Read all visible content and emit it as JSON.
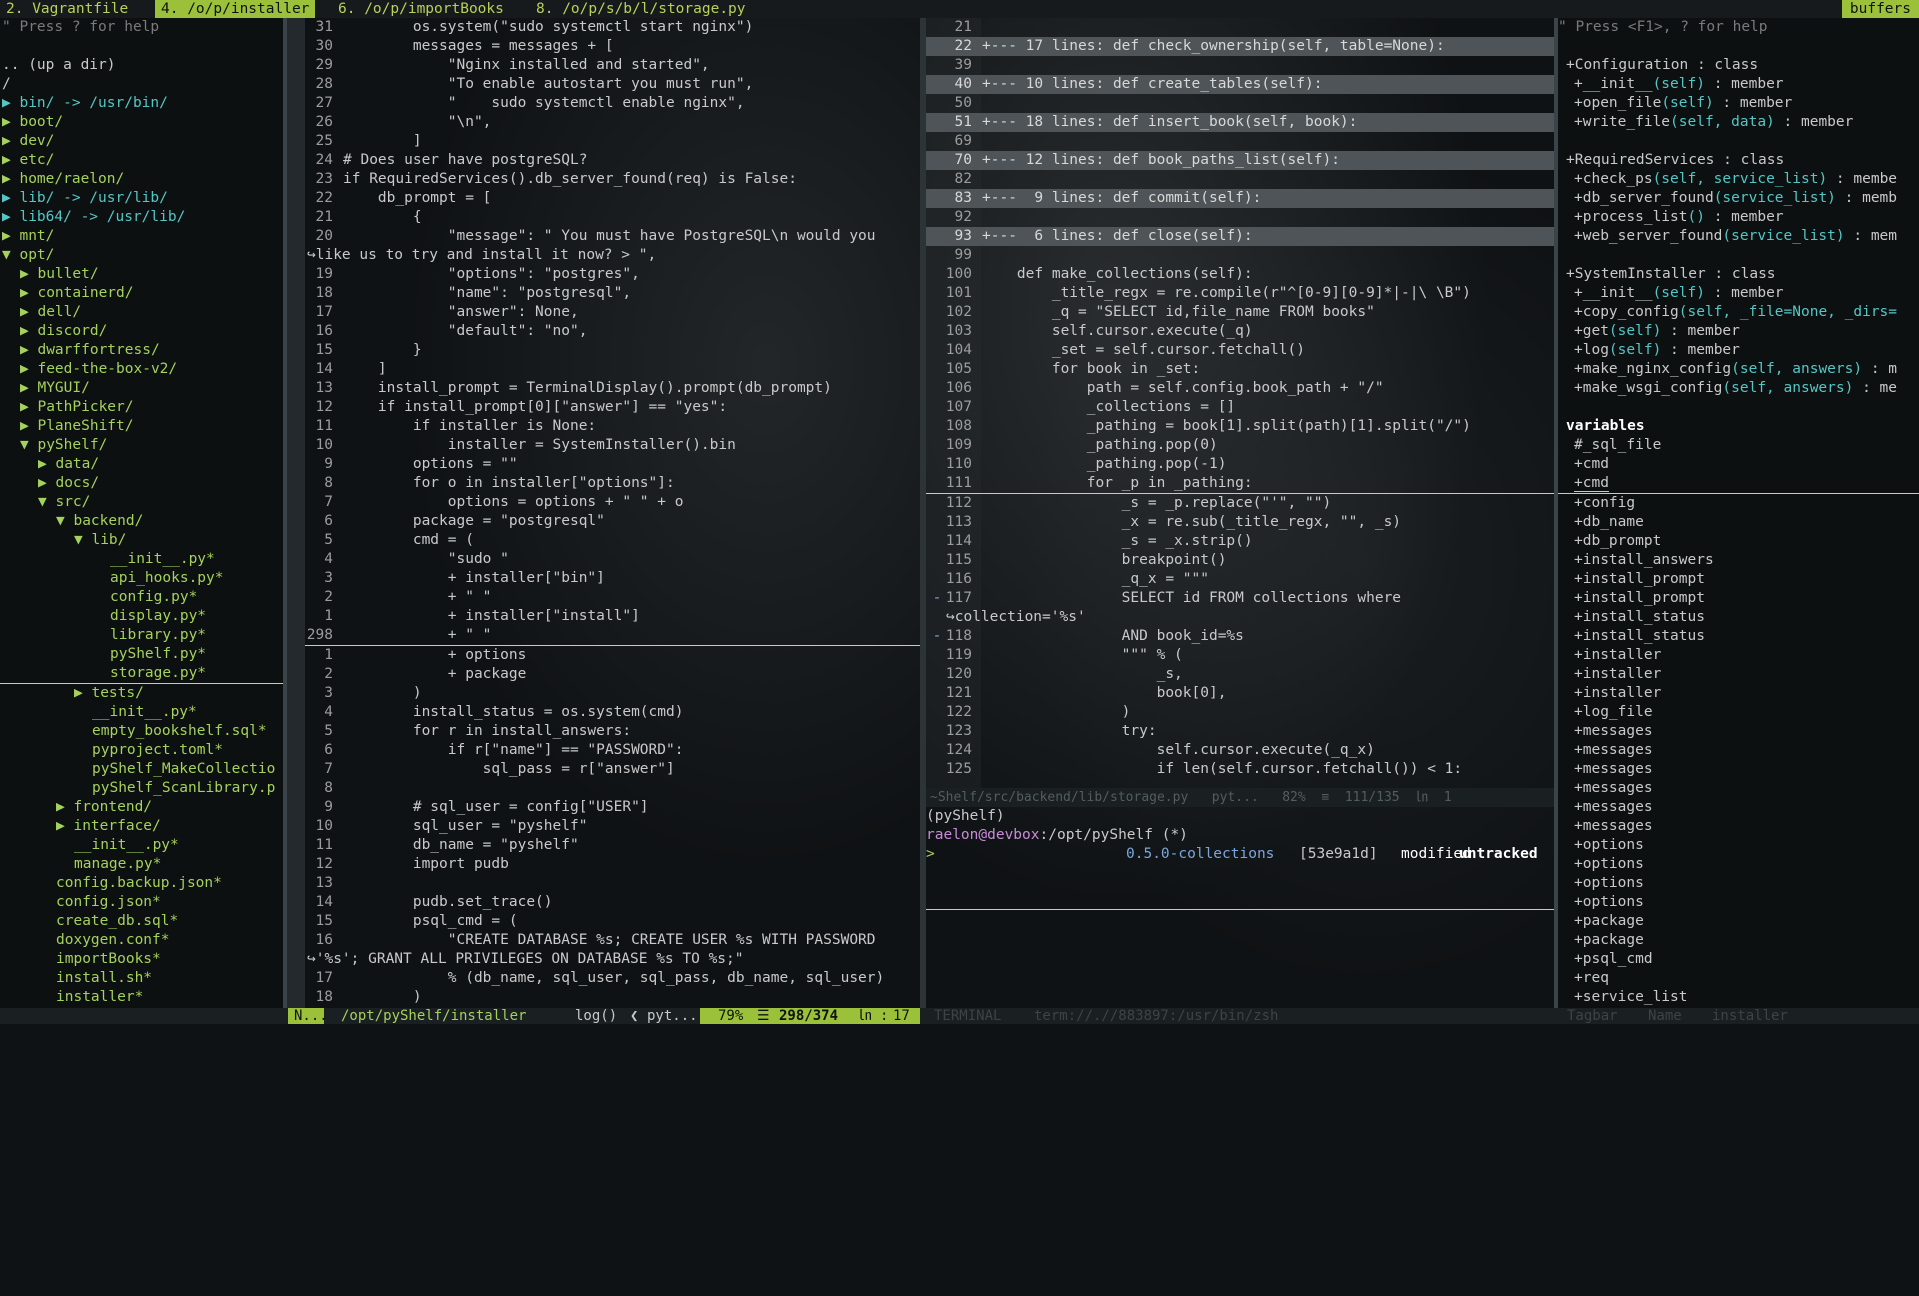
{
  "tabs": [
    {
      "label": "2. Vagrantfile"
    },
    {
      "label": "4. /o/p/installer"
    },
    {
      "label": "6. /o/p/importBooks"
    },
    {
      "label": "8. /o/p/s/b/l/storage.py"
    }
  ],
  "buffers_label": "buffers",
  "tree": {
    "header": "\" Press ? for help",
    "up": ".. (up a dir)",
    "root": "/",
    "items": [
      {
        "text": "▶ bin/ -> /usr/bin/",
        "color": "#54c6c6",
        "indent": 0
      },
      {
        "text": "▶ boot/",
        "color": "#a5d15d",
        "indent": 0
      },
      {
        "text": "▶ dev/",
        "color": "#a5d15d",
        "indent": 0
      },
      {
        "text": "▶ etc/",
        "color": "#a5d15d",
        "indent": 0
      },
      {
        "text": "▶ home/raelon/",
        "color": "#a5d15d",
        "indent": 0
      },
      {
        "text": "▶ lib/ -> /usr/lib/",
        "color": "#54c6c6",
        "indent": 0
      },
      {
        "text": "▶ lib64/ -> /usr/lib/",
        "color": "#54c6c6",
        "indent": 0
      },
      {
        "text": "▶ mnt/",
        "color": "#a5d15d",
        "indent": 0
      },
      {
        "text": "▼ opt/",
        "color": "#a5d15d",
        "indent": 0
      },
      {
        "text": "▶ bullet/",
        "color": "#a5d15d",
        "indent": 1
      },
      {
        "text": "▶ containerd/",
        "color": "#a5d15d",
        "indent": 1
      },
      {
        "text": "▶ dell/",
        "color": "#a5d15d",
        "indent": 1
      },
      {
        "text": "▶ discord/",
        "color": "#a5d15d",
        "indent": 1
      },
      {
        "text": "▶ dwarffortress/",
        "color": "#a5d15d",
        "indent": 1
      },
      {
        "text": "▶ feed-the-box-v2/",
        "color": "#a5d15d",
        "indent": 1
      },
      {
        "text": "▶ MYGUI/",
        "color": "#a5d15d",
        "indent": 1
      },
      {
        "text": "▶ PathPicker/",
        "color": "#a5d15d",
        "indent": 1
      },
      {
        "text": "▶ PlaneShift/",
        "color": "#a5d15d",
        "indent": 1
      },
      {
        "text": "▼ pyShelf/",
        "color": "#a5d15d",
        "indent": 1
      },
      {
        "text": "▶ data/",
        "color": "#a5d15d",
        "indent": 2
      },
      {
        "text": "▶ docs/",
        "color": "#a5d15d",
        "indent": 2
      },
      {
        "text": "▼ src/",
        "color": "#a5d15d",
        "indent": 2
      },
      {
        "text": "▼ backend/",
        "color": "#a5d15d",
        "indent": 3
      },
      {
        "text": "▼ lib/",
        "color": "#a5d15d",
        "indent": 4
      },
      {
        "text": "__init__.py*",
        "color": "#a5d15d",
        "indent": 6
      },
      {
        "text": "api_hooks.py*",
        "color": "#a5d15d",
        "indent": 6
      },
      {
        "text": "config.py*",
        "color": "#a5d15d",
        "indent": 6
      },
      {
        "text": "display.py*",
        "color": "#a5d15d",
        "indent": 6
      },
      {
        "text": "library.py*",
        "color": "#a5d15d",
        "indent": 6
      },
      {
        "text": "pyShelf.py*",
        "color": "#a5d15d",
        "indent": 6
      },
      {
        "text": "storage.py*",
        "color": "#a5d15d",
        "indent": 6,
        "cursor": true
      },
      {
        "text": "▶ tests/",
        "color": "#a5d15d",
        "indent": 4
      },
      {
        "text": "__init__.py*",
        "color": "#a5d15d",
        "indent": 5
      },
      {
        "text": "empty_bookshelf.sql*",
        "color": "#a5d15d",
        "indent": 5
      },
      {
        "text": "pyproject.toml*",
        "color": "#a5d15d",
        "indent": 5
      },
      {
        "text": "pyShelf_MakeCollectio",
        "color": "#a5d15d",
        "indent": 5
      },
      {
        "text": "pyShelf_ScanLibrary.p",
        "color": "#a5d15d",
        "indent": 5
      },
      {
        "text": "▶ frontend/",
        "color": "#a5d15d",
        "indent": 3
      },
      {
        "text": "▶ interface/",
        "color": "#a5d15d",
        "indent": 3
      },
      {
        "text": "__init__.py*",
        "color": "#a5d15d",
        "indent": 4
      },
      {
        "text": "manage.py*",
        "color": "#a5d15d",
        "indent": 4
      },
      {
        "text": "config.backup.json*",
        "color": "#a5d15d",
        "indent": 3
      },
      {
        "text": "config.json*",
        "color": "#a5d15d",
        "indent": 3
      },
      {
        "text": "create_db.sql*",
        "color": "#a5d15d",
        "indent": 3
      },
      {
        "text": "doxygen.conf*",
        "color": "#a5d15d",
        "indent": 3
      },
      {
        "text": "importBooks*",
        "color": "#a5d15d",
        "indent": 3
      },
      {
        "text": "install.sh*",
        "color": "#a5d15d",
        "indent": 3
      },
      {
        "text": "installer*",
        "color": "#a5d15d",
        "indent": 3
      }
    ]
  },
  "editor_left": {
    "lines": [
      {
        "n": "31",
        "t": "        os.system(\"sudo systemctl start nginx\")"
      },
      {
        "n": "30",
        "t": "        messages = messages + ["
      },
      {
        "n": "29",
        "t": "            \"Nginx installed and started\","
      },
      {
        "n": "28",
        "t": "            \"To enable autostart you must run\","
      },
      {
        "n": "27",
        "t": "            \"    sudo systemctl enable nginx\","
      },
      {
        "n": "26",
        "t": "            \"\\n\","
      },
      {
        "n": "25",
        "t": "        ]"
      },
      {
        "n": "24",
        "t": "# Does user have postgreSQL?"
      },
      {
        "n": "23",
        "t": "if RequiredServices().db_server_found(req) is False:"
      },
      {
        "n": "22",
        "t": "    db_prompt = ["
      },
      {
        "n": "21",
        "t": "        {"
      },
      {
        "n": "20",
        "t": "            \"message\": \" You must have PostgreSQL\\n would you",
        "sign": ">>"
      },
      {
        "n": "",
        "t": "↪like us to try and install it now? > \","
      },
      {
        "n": "19",
        "t": "            \"options\": \"postgres\","
      },
      {
        "n": "18",
        "t": "            \"name\": \"postgresql\","
      },
      {
        "n": "17",
        "t": "            \"answer\": None,"
      },
      {
        "n": "16",
        "t": "            \"default\": \"no\","
      },
      {
        "n": "15",
        "t": "        }"
      },
      {
        "n": "14",
        "t": "    ]"
      },
      {
        "n": "13",
        "t": "    install_prompt = TerminalDisplay().prompt(db_prompt)"
      },
      {
        "n": "12",
        "t": "    if install_prompt[0][\"answer\"] == \"yes\":"
      },
      {
        "n": "11",
        "t": "        if installer is None:"
      },
      {
        "n": "10",
        "t": "            installer = SystemInstaller().bin"
      },
      {
        "n": "9",
        "t": "        options = \"\""
      },
      {
        "n": "8",
        "t": "        for o in installer[\"options\"]:"
      },
      {
        "n": "7",
        "t": "            options = options + \" \" + o"
      },
      {
        "n": "6",
        "t": "        package = \"postgresql\""
      },
      {
        "n": "5",
        "t": "        cmd = ("
      },
      {
        "n": "4",
        "t": "            \"sudo \""
      },
      {
        "n": "3",
        "t": "            + installer[\"bin\"]"
      },
      {
        "n": "2",
        "t": "            + \" \""
      },
      {
        "n": "1",
        "t": "            + installer[\"install\"]"
      },
      {
        "n": "298",
        "t": "            + \" \"",
        "current": true
      },
      {
        "n": "1",
        "t": "            + options"
      },
      {
        "n": "2",
        "t": "            + package"
      },
      {
        "n": "3",
        "t": "        )"
      },
      {
        "n": "4",
        "t": "        install_status = os.system(cmd)"
      },
      {
        "n": "5",
        "t": "        for r in install_answers:"
      },
      {
        "n": "6",
        "t": "            if r[\"name\"] == \"PASSWORD\":"
      },
      {
        "n": "7",
        "t": "                sql_pass = r[\"answer\"]"
      },
      {
        "n": "8",
        "t": ""
      },
      {
        "n": "9",
        "t": "        # sql_user = config[\"USER\"]"
      },
      {
        "n": "10",
        "t": "        sql_user = \"pyshelf\""
      },
      {
        "n": "11",
        "t": "        db_name = \"pyshelf\""
      },
      {
        "n": "12",
        "t": "        import pudb",
        "sign": ">>"
      },
      {
        "n": "13",
        "t": ""
      },
      {
        "n": "14",
        "t": "        pudb.set_trace()"
      },
      {
        "n": "15",
        "t": "        psql_cmd = ("
      },
      {
        "n": "16",
        "t": "            \"CREATE DATABASE %s; CREATE USER %s WITH PASSWORD",
        "sign": ">>"
      },
      {
        "n": "",
        "t": "↪'%s'; GRANT ALL PRIVILEGES ON DATABASE %s TO %s;\""
      },
      {
        "n": "17",
        "t": "            % (db_name, sql_user, sql_pass, db_name, sql_user)"
      },
      {
        "n": "18",
        "t": "        )"
      }
    ]
  },
  "editor_right": {
    "lines": [
      {
        "n": "21",
        "t": ""
      },
      {
        "n": "22",
        "t": "+--- 17 lines: def check_ownership(self, table=None):",
        "fold": true
      },
      {
        "n": "39",
        "t": ""
      },
      {
        "n": "40",
        "t": "+--- 10 lines: def create_tables(self):",
        "fold": true
      },
      {
        "n": "50",
        "t": ""
      },
      {
        "n": "51",
        "t": "+--- 18 lines: def insert_book(self, book):",
        "fold": true
      },
      {
        "n": "69",
        "t": ""
      },
      {
        "n": "70",
        "t": "+--- 12 lines: def book_paths_list(self):",
        "fold": true
      },
      {
        "n": "82",
        "t": ""
      },
      {
        "n": "83",
        "t": "+---  9 lines: def commit(self):",
        "fold": true
      },
      {
        "n": "92",
        "t": ""
      },
      {
        "n": "93",
        "t": "+---  6 lines: def close(self):",
        "fold": true
      },
      {
        "n": "99",
        "t": ""
      },
      {
        "n": "100",
        "t": "    def make_collections(self):"
      },
      {
        "n": "101",
        "t": "        _title_regx = re.compile(r\"^[0-9][0-9]*|-|\\ \\B\")"
      },
      {
        "n": "102",
        "t": "        _q = \"SELECT id,file_name FROM books\""
      },
      {
        "n": "103",
        "t": "        self.cursor.execute(_q)"
      },
      {
        "n": "104",
        "t": "        _set = self.cursor.fetchall()"
      },
      {
        "n": "105",
        "t": "        for book in _set:"
      },
      {
        "n": "106",
        "t": "            path = self.config.book_path + \"/\""
      },
      {
        "n": "107",
        "t": "            _collections = []"
      },
      {
        "n": "108",
        "t": "            _pathing = book[1].split(path)[1].split(\"/\")"
      },
      {
        "n": "109",
        "t": "            _pathing.pop(0)"
      },
      {
        "n": "110",
        "t": "            _pathing.pop(-1)"
      },
      {
        "n": "111",
        "t": "            for _p in _pathing:",
        "current": true
      },
      {
        "n": "112",
        "t": "                _s = _p.replace(\"'\", \"\")"
      },
      {
        "n": "113",
        "t": "                _x = re.sub(_title_regx, \"\", _s)"
      },
      {
        "n": "114",
        "t": "                _s = _x.strip()"
      },
      {
        "n": "115",
        "t": "                breakpoint()"
      },
      {
        "n": "116",
        "t": "                _q_x = \"\"\""
      },
      {
        "n": "117",
        "t": "                SELECT id FROM collections where",
        "sign": "-"
      },
      {
        "n": "",
        "t": "↪collection='%s'"
      },
      {
        "n": "118",
        "t": "                AND book_id=%s",
        "sign": "-"
      },
      {
        "n": "119",
        "t": "                \"\"\" % ("
      },
      {
        "n": "120",
        "t": "                    _s,"
      },
      {
        "n": "121",
        "t": "                    book[0],"
      },
      {
        "n": "122",
        "t": "                )"
      },
      {
        "n": "123",
        "t": "                try:"
      },
      {
        "n": "124",
        "t": "                    self.cursor.execute(_q_x)"
      },
      {
        "n": "125",
        "t": "                    if len(self.cursor.fetchall()) < 1:"
      }
    ],
    "status": "~Shelf/src/backend/lib/storage.py   pyt...   82%  ≡  111/135  ㏑  1"
  },
  "terminal": {
    "line1": "(pyShelf)",
    "user": "raelon@devbox",
    "path": ":/opt/pyShelf (*)",
    "prompt": ">",
    "branch": "0.5.0-collections",
    "hash": "[53e9a1d]",
    "modified": "modified",
    "untracked": "untracked"
  },
  "tagbar": {
    "header": "\" Press <F1>, ? for help",
    "groups": [
      {
        "name": "+Configuration",
        "kind": " : class",
        "members": [
          {
            "name": "+__init__",
            "args": "(self)",
            "kind": " : member"
          },
          {
            "name": "+open_file",
            "args": "(self)",
            "kind": " : member"
          },
          {
            "name": "+write_file",
            "args": "(self, data)",
            "kind": " : member"
          }
        ]
      },
      {
        "name": "+RequiredServices",
        "kind": " : class",
        "members": [
          {
            "name": "+check_ps",
            "args": "(self, service_list)",
            "kind": " : membe"
          },
          {
            "name": "+db_server_found",
            "args": "(service_list)",
            "kind": " : memb"
          },
          {
            "name": "+process_list",
            "args": "()",
            "kind": " : member"
          },
          {
            "name": "+web_server_found",
            "args": "(service_list)",
            "kind": " : mem"
          }
        ]
      },
      {
        "name": "+SystemInstaller",
        "kind": " : class",
        "members": [
          {
            "name": "+__init__",
            "args": "(self)",
            "kind": " : member"
          },
          {
            "name": "+copy_config",
            "args": "(self, _file=None, _dirs=",
            "kind": ""
          },
          {
            "name": "+get",
            "args": "(self)",
            "kind": " : member"
          },
          {
            "name": "+log",
            "args": "(self)",
            "kind": " : member"
          },
          {
            "name": "+make_nginx_config",
            "args": "(self, answers)",
            "kind": " : m"
          },
          {
            "name": "+make_wsgi_config",
            "args": "(self, answers)",
            "kind": " : me"
          }
        ]
      }
    ],
    "variables_label": "variables",
    "variables": [
      "#_sql_file",
      "+cmd",
      "+cmd",
      "+config",
      "+db_name",
      "+db_prompt",
      "+install_answers",
      "+install_prompt",
      "+install_prompt",
      "+install_status",
      "+install_status",
      "+installer",
      "+installer",
      "+installer",
      "+log_file",
      "+messages",
      "+messages",
      "+messages",
      "+messages",
      "+messages",
      "+messages",
      "+options",
      "+options",
      "+options",
      "+options",
      "+package",
      "+package",
      "+psql_cmd",
      "+req",
      "+service_list"
    ]
  },
  "statusline": {
    "mode": "N...",
    "path": "/opt/pyShelf/installer",
    "func": "log()",
    "ft": "pyt...",
    "percent": "79%",
    "pos": "298/374",
    "col": "17",
    "term_label": "TERMINAL",
    "term_path": "term://.//883897:/usr/bin/zsh",
    "tag_label": "Tagbar",
    "tag_name": "Name",
    "tag_file": "installer"
  },
  "colors": {
    "accent": "#9bc13a",
    "dir": "#a5d15d",
    "link": "#54c6c6",
    "fold_bg": "#4e5457"
  }
}
